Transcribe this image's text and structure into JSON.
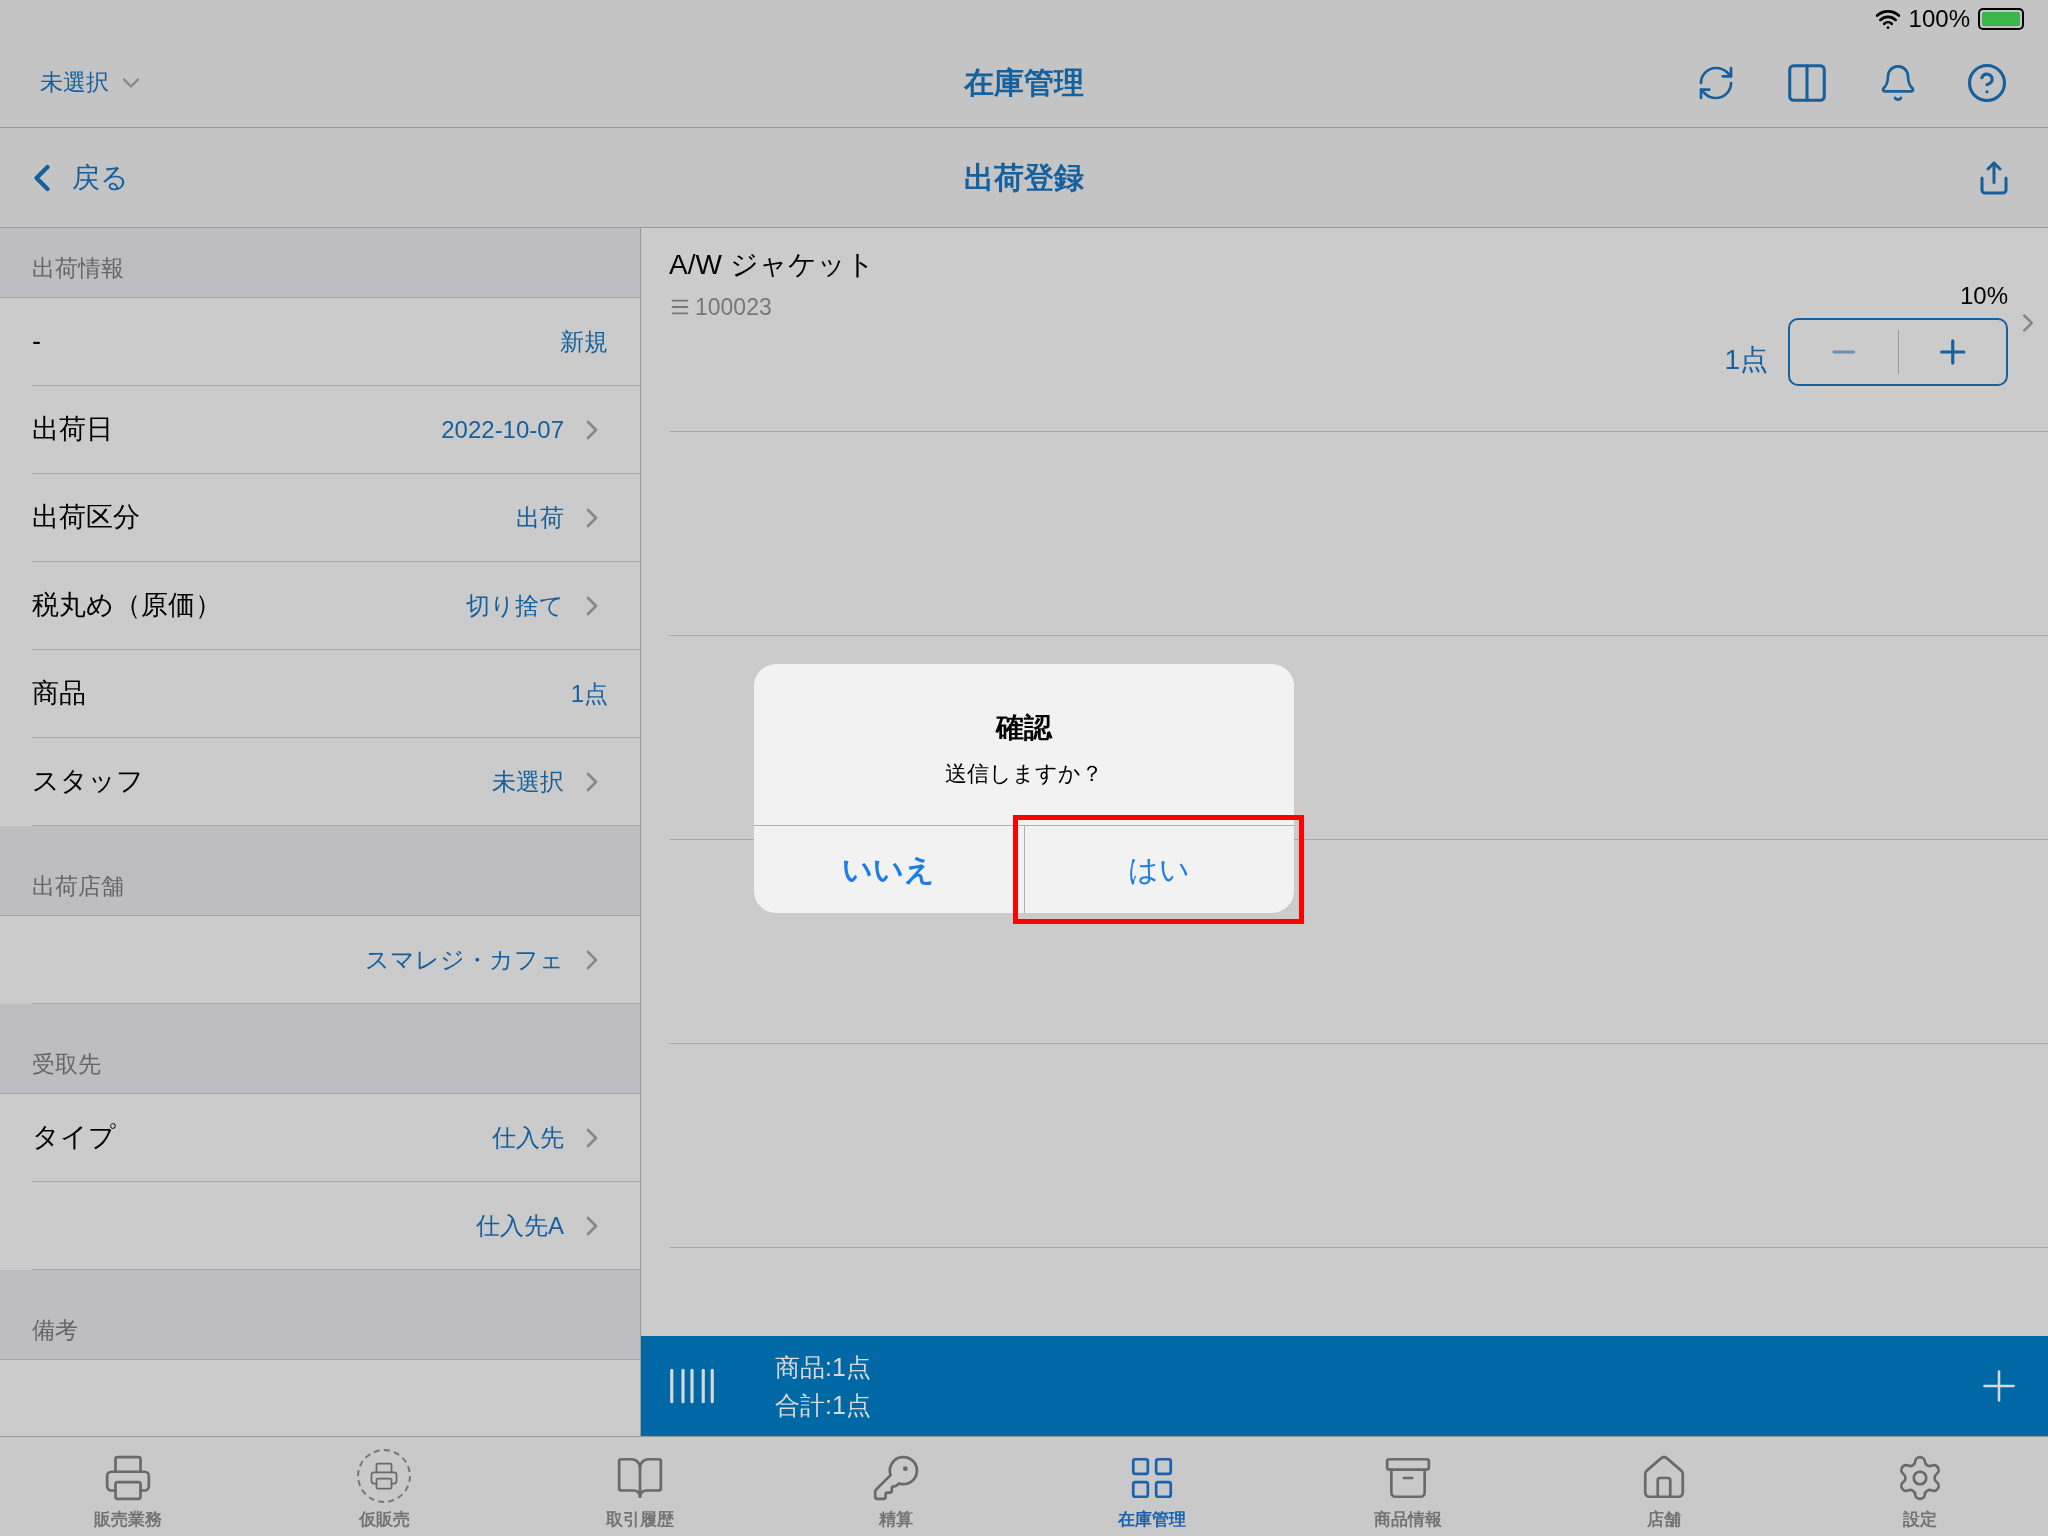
{
  "status_bar": {
    "battery": "100%"
  },
  "top_nav": {
    "store": "未選択",
    "title": "在庫管理"
  },
  "sub_nav": {
    "back": "戻る",
    "title": "出荷登録"
  },
  "left_sections": [
    {
      "header": "出荷情報",
      "rows": [
        {
          "label": "-",
          "value": "新規",
          "chevron": false
        },
        {
          "label": "出荷日",
          "value": "2022-10-07",
          "chevron": true
        },
        {
          "label": "出荷区分",
          "value": "出荷",
          "chevron": true
        },
        {
          "label": "税丸め（原価）",
          "value": "切り捨て",
          "chevron": true
        },
        {
          "label": "商品",
          "value": "1点",
          "chevron": false
        },
        {
          "label": "スタッフ",
          "value": "未選択",
          "chevron": true
        }
      ]
    },
    {
      "header": "出荷店舗",
      "rows": [
        {
          "value": "スマレジ・カフェ",
          "chevron": true
        }
      ]
    },
    {
      "header": "受取先",
      "rows": [
        {
          "label": "タイプ",
          "value": "仕入先",
          "chevron": true
        },
        {
          "value": "仕入先A",
          "chevron": true
        }
      ]
    },
    {
      "header": "備考"
    }
  ],
  "product": {
    "name": "A/W ジャケット",
    "code": "100023",
    "rate": "10%",
    "quantity": "1点"
  },
  "summary_bar": {
    "items": "商品:1点",
    "total": "合計:1点"
  },
  "tabs": [
    {
      "label": "販売業務",
      "selected": false
    },
    {
      "label": "仮販売",
      "selected": false
    },
    {
      "label": "取引履歴",
      "selected": false
    },
    {
      "label": "精算",
      "selected": false
    },
    {
      "label": "在庫管理",
      "selected": true
    },
    {
      "label": "商品情報",
      "selected": false
    },
    {
      "label": "店舗",
      "selected": false
    },
    {
      "label": "設定",
      "selected": false
    }
  ],
  "dialog": {
    "title": "確認",
    "message": "送信しますか？",
    "buttons": [
      {
        "label": "いいえ",
        "bold": true,
        "highlighted": false
      },
      {
        "label": "はい",
        "bold": false,
        "highlighted": true
      }
    ]
  }
}
